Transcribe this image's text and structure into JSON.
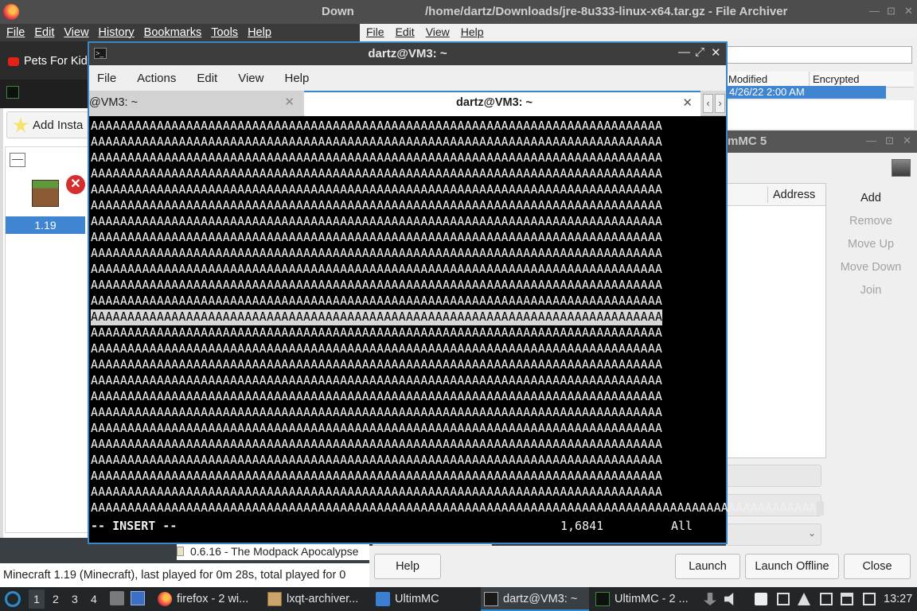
{
  "firefox": {
    "title_partial": "Down",
    "menu": [
      "File",
      "Edit",
      "View",
      "History",
      "Bookmarks",
      "Tools",
      "Help"
    ],
    "bookmark": "Pets For Kid"
  },
  "ultimmc": {
    "add_instance": "Add Insta",
    "instance_version": "1.19",
    "modpack_line": "0.6.16 - The Modpack Apocalypse",
    "status": "Minecraft 1.19 (Minecraft), last played for 0m 28s, total played for 0",
    "buttons": {
      "help": "Help",
      "launch": "Launch",
      "launch_offline": "Launch Offline",
      "close": "Close"
    }
  },
  "archiver": {
    "title": "/home/dartz/Downloads/jre-8u333-linux-x64.tar.gz - File Archiver",
    "menu": [
      "File",
      "Edit",
      "View",
      "Help"
    ],
    "columns": [
      "Modified",
      "Encrypted"
    ],
    "row_modified": "4/26/22 2:00 AM"
  },
  "servers": {
    "title": "mMC 5",
    "column_address": "Address",
    "buttons": [
      "Add",
      "Remove",
      "Move Up",
      "Move Down",
      "Join"
    ]
  },
  "terminal": {
    "title": "dartz@VM3: ~",
    "menu": [
      "File",
      "Actions",
      "Edit",
      "View",
      "Help"
    ],
    "tab1": "@VM3: ~",
    "tab2": "dartz@VM3: ~",
    "full_line": "AAAAAAAAAAAAAAAAAAAAAAAAAAAAAAAAAAAAAAAAAAAAAAAAAAAAAAAAAAAAAAAAAAAAAAAAAAAAAA",
    "last_line": "AAAAAAAAAAAAAAAAAAAAAAAAAAAAAAAAAAAAAAAAAAAAAAAAAAAAAAAAAAAAAAAAAAAAAAAAAAAAAAAAAAAAAAAAAAAAAAAAAAA",
    "highlight_line_index": 12,
    "mode": "-- INSERT --",
    "position": "1,6841",
    "scroll": "All"
  },
  "taskbar": {
    "workspaces": [
      "1",
      "2",
      "3",
      "4"
    ],
    "tasks": [
      {
        "label": "firefox - 2 wi...",
        "icon": "firefox-icon"
      },
      {
        "label": "lxqt-archiver...",
        "icon": "archive-icon"
      },
      {
        "label": "UltimMC",
        "icon": "folder-icon"
      },
      {
        "label": "dartz@VM3: ~",
        "icon": "terminal-icon"
      },
      {
        "label": "UltimMC - 2 ...",
        "icon": "ultimmc-icon"
      }
    ],
    "clock": "13:27"
  }
}
